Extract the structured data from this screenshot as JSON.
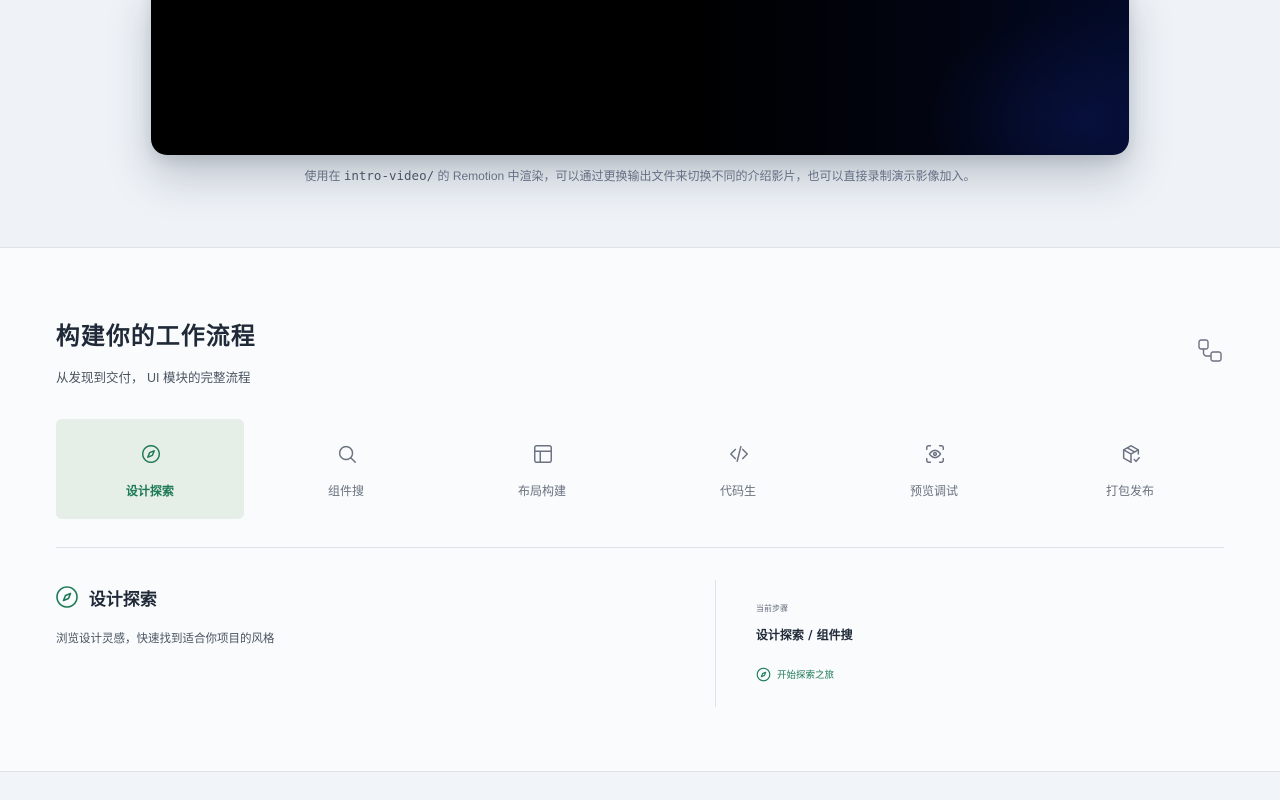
{
  "video": {
    "caption_prefix": "使用在",
    "caption_code": "intro-video/",
    "caption_suffix": "的 Remotion 中渲染，可以通过更换输出文件来切换不同的介绍影片，也可以直接录制演示影像加入。"
  },
  "section": {
    "title": "构建你的工作流程",
    "subtitle": "从发现到交付， UI 模块的完整流程"
  },
  "steps": [
    {
      "label": "设计探索",
      "icon": "compass-icon",
      "active": true
    },
    {
      "label": "组件搜",
      "icon": "search-icon",
      "active": false
    },
    {
      "label": "布局构建",
      "icon": "layout-icon",
      "active": false
    },
    {
      "label": "代码生",
      "icon": "code-icon",
      "active": false
    },
    {
      "label": "预览调试",
      "icon": "eye-scan-icon",
      "active": false
    },
    {
      "label": "打包发布",
      "icon": "package-check-icon",
      "active": false
    }
  ],
  "detail": {
    "title": "设计探索",
    "description": "浏览设计灵感，快速找到适合你项目的风格",
    "meta_label": "当前步骤",
    "meta_value": "设计探索 / 组件搜",
    "link_label": "开始探索之旅"
  },
  "colors": {
    "accent": "#1e7a55",
    "active_bg": "#e5efe8",
    "muted": "#6b7280"
  }
}
